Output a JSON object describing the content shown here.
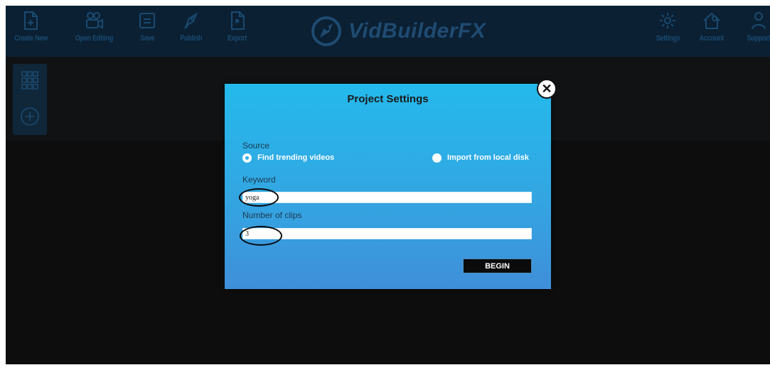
{
  "toolbar": {
    "items": [
      {
        "label": "Create New",
        "icon": "file-plus-icon"
      },
      {
        "label": "Open Editing",
        "icon": "folder-camera-icon"
      },
      {
        "label": "Save",
        "icon": "save-icon"
      },
      {
        "label": "Publish",
        "icon": "rocket-icon"
      },
      {
        "label": "Export",
        "icon": "export-icon"
      }
    ],
    "right_items": [
      {
        "label": "Settings",
        "icon": "gear-icon"
      },
      {
        "label": "Account",
        "icon": "home-gear-icon"
      },
      {
        "label": "Support",
        "icon": "support-icon"
      }
    ],
    "brand": "VidBuilderFX"
  },
  "modal": {
    "title": "Project Settings",
    "source_label": "Source",
    "options": [
      {
        "label": "Find trending videos",
        "selected": true
      },
      {
        "label": "Import from local disk",
        "selected": false
      }
    ],
    "keyword_label": "Keyword",
    "keyword_value": "yoga",
    "clips_label": "Number of clips",
    "clips_value": "3",
    "begin_label": "BEGIN"
  },
  "colors": {
    "toolbar_bg": "#0b2033",
    "toolbar_icon": "#1a4a70",
    "modal_top": "#24b9ec",
    "modal_bottom": "#3f8fd9"
  }
}
